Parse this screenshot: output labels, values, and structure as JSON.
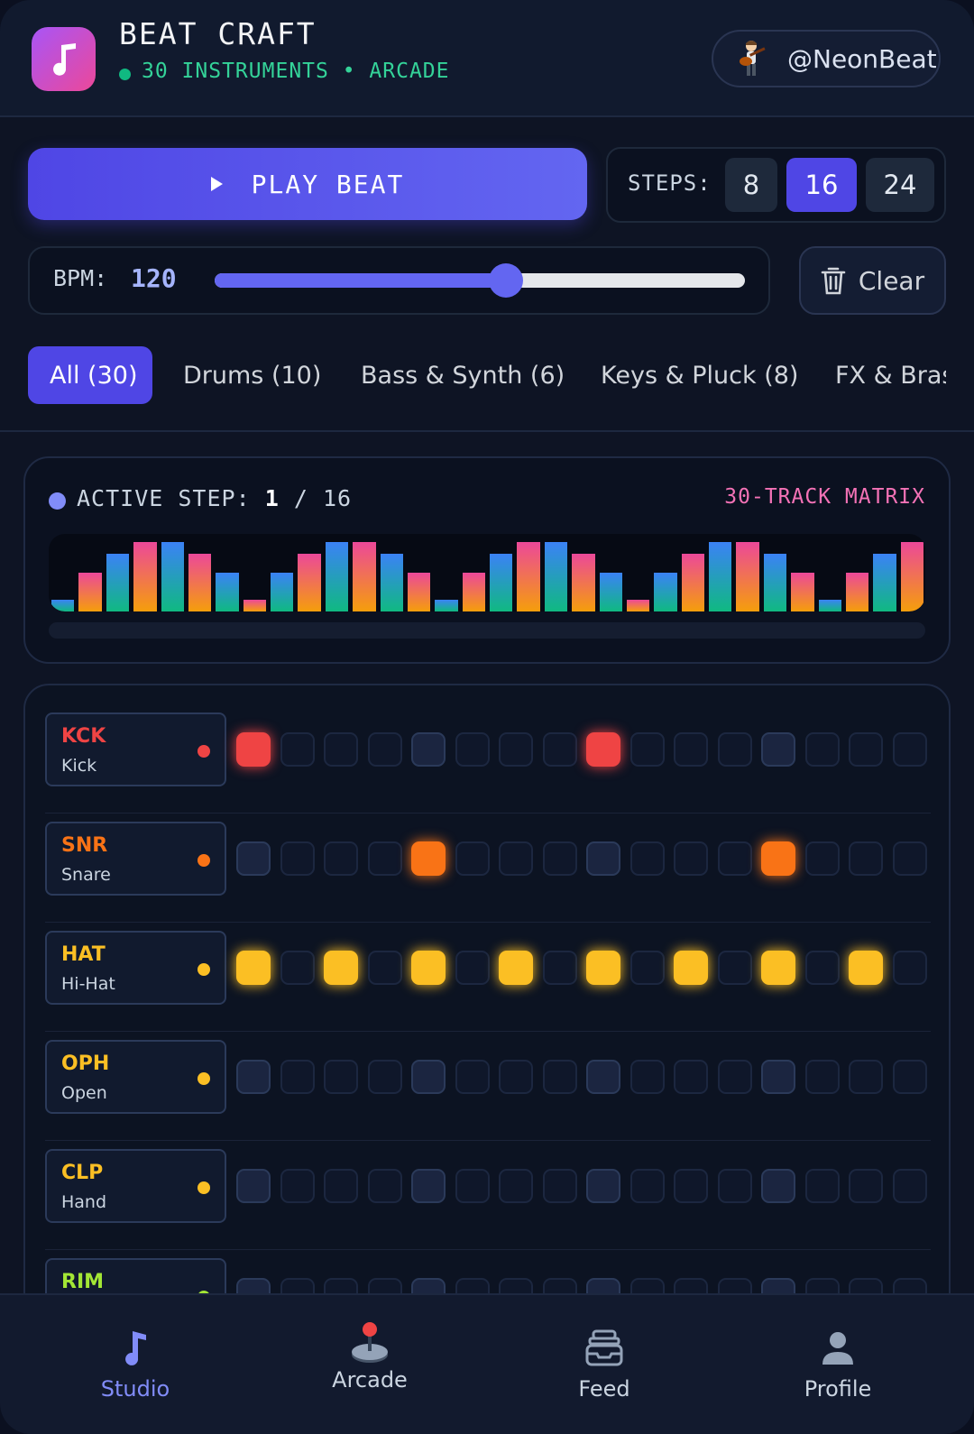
{
  "header": {
    "title": "BEAT CRAFT",
    "subtitle": "30 INSTRUMENTS • ARCADE",
    "username": "@NeonBeat"
  },
  "controls": {
    "play_label": "PLAY BEAT",
    "steps_label": "STEPS:",
    "steps_options": [
      "8",
      "16",
      "24"
    ],
    "steps_selected": "16",
    "bpm_label": "BPM:",
    "bpm_value": "120",
    "bpm_slider_fraction": 0.55,
    "clear_label": "Clear"
  },
  "tabs": [
    {
      "label": "All (30)",
      "active": true
    },
    {
      "label": "Drums (10)",
      "active": false
    },
    {
      "label": "Bass & Synth (6)",
      "active": false
    },
    {
      "label": "Keys & Pluck (8)",
      "active": false
    },
    {
      "label": "FX & Brass",
      "active": false
    }
  ],
  "visualizer": {
    "active_label": "ACTIVE STEP:",
    "current_step": "1",
    "separator": "/",
    "total_steps": "16",
    "matrix_label": "30-TRACK MATRIX",
    "bar_levels": [
      0.15,
      0.5,
      0.75,
      0.9,
      0.9,
      0.75,
      0.5,
      0.15,
      0.5,
      0.75,
      0.9,
      0.9,
      0.75,
      0.5,
      0.15,
      0.5,
      0.75,
      0.9,
      0.9,
      0.75,
      0.5,
      0.15,
      0.5,
      0.75,
      0.9,
      0.9,
      0.75,
      0.5,
      0.15,
      0.5,
      0.75,
      0.9
    ]
  },
  "tracks": [
    {
      "code": "KCK",
      "name": "Kick",
      "color": "#ef4444",
      "on": [
        0,
        8
      ]
    },
    {
      "code": "SNR",
      "name": "Snare",
      "color": "#f97316",
      "on": [
        4,
        12
      ]
    },
    {
      "code": "HAT",
      "name": "Hi-Hat",
      "color": "#fbbf24",
      "on": [
        0,
        2,
        4,
        6,
        8,
        10,
        12,
        14
      ]
    },
    {
      "code": "OPH",
      "name": "Open",
      "color": "#fbbf24",
      "on": []
    },
    {
      "code": "CLP",
      "name": "Hand",
      "color": "#fbbf24",
      "on": []
    },
    {
      "code": "RIM",
      "name": "",
      "color": "#a3e635",
      "on": []
    }
  ],
  "nav": [
    {
      "label": "Studio",
      "icon": "music-note-icon",
      "active": true
    },
    {
      "label": "Arcade",
      "icon": "joystick-icon",
      "active": false
    },
    {
      "label": "Feed",
      "icon": "inbox-tray-icon",
      "active": false
    },
    {
      "label": "Profile",
      "icon": "person-icon",
      "active": false
    }
  ],
  "colors": {
    "accent": "#4f46e5",
    "live": "#10b981",
    "matrix": "#f472b6"
  }
}
